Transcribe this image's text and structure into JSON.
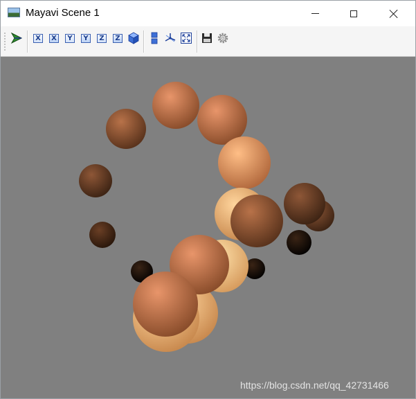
{
  "window": {
    "title": "Mayavi Scene 1",
    "icon": "mayavi-scene-icon"
  },
  "title_controls": [
    {
      "name": "minimize-button",
      "icon": "minimize-icon"
    },
    {
      "name": "maximize-button",
      "icon": "maximize-icon"
    },
    {
      "name": "close-button",
      "icon": "close-icon"
    }
  ],
  "toolbar": {
    "pipeline_icon": "mayavi-pipeline-icon",
    "views": [
      {
        "label": "X",
        "icon": "view-x-minus-icon"
      },
      {
        "label": "X",
        "icon": "view-x-plus-icon"
      },
      {
        "label": "Y",
        "icon": "view-y-minus-icon"
      },
      {
        "label": "Y",
        "icon": "view-y-plus-icon"
      },
      {
        "label": "Z",
        "icon": "view-z-minus-icon"
      },
      {
        "label": "Z",
        "icon": "view-z-plus-icon"
      }
    ],
    "isometric_icon": "isometric-cube-icon",
    "parallel_icon": "parallel-projection-icon",
    "axes_icon": "toggle-axes-icon",
    "fullscreen_icon": "fullscreen-icon",
    "save_icon": "save-icon",
    "settings_icon": "settings-gear-icon"
  },
  "scene": {
    "background_color": "#808080",
    "sphere_color_dark": "#1a0d06",
    "sphere_color_light": "#fcd9a0",
    "watermark": "https://blog.csdn.net/qq_42731466"
  }
}
